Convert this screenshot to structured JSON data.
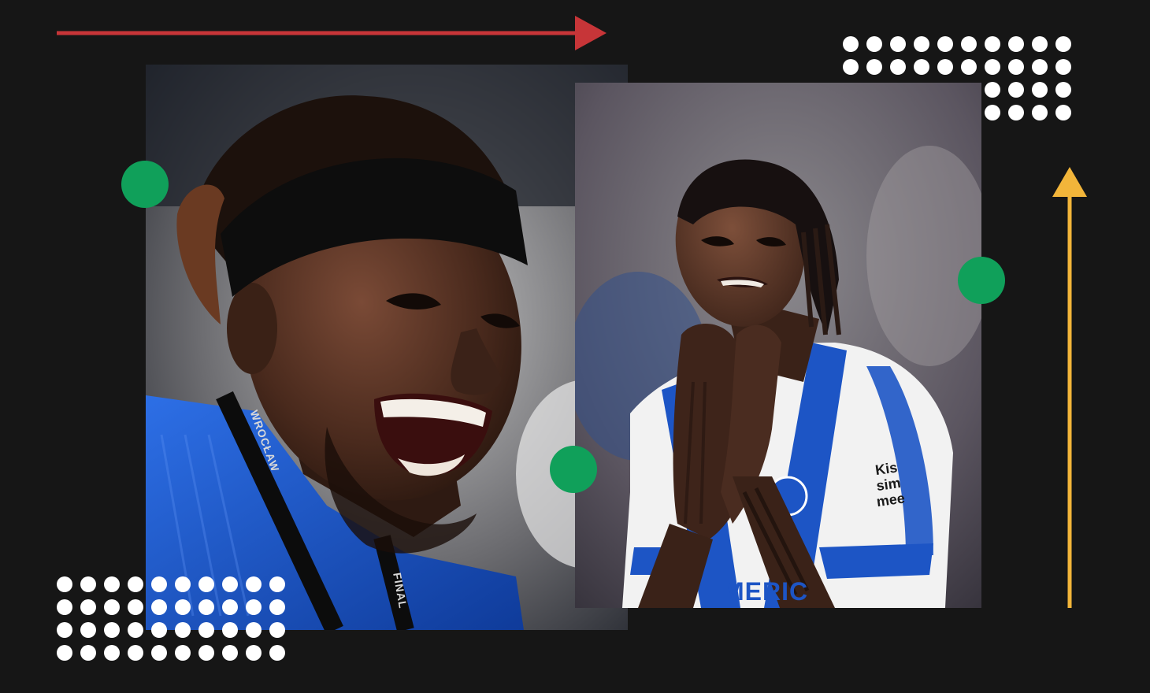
{
  "graphic": {
    "colors": {
      "background": "#161616",
      "accent_red": "#c73538",
      "accent_yellow": "#f2b53a",
      "accent_green": "#10a05a",
      "dots": "#ffffff",
      "kit_blue": "#1f5fd0",
      "kit_white": "#f2f2f2"
    },
    "left_photo": {
      "subject": "smiling footballer in blue kit with black headband and medal lanyard",
      "lanyard_text": "WROCŁAW",
      "lanyard_text_2": "FINAL"
    },
    "right_photo": {
      "subject": "footballer in blue and white striped kit with hands on chin",
      "sleeve_sponsor": "Kis sim mee",
      "front_sponsor_fragment": "MERIC"
    },
    "icons": [
      "arrow-right-icon",
      "arrow-up-icon",
      "dot-grid",
      "green-circle"
    ]
  }
}
